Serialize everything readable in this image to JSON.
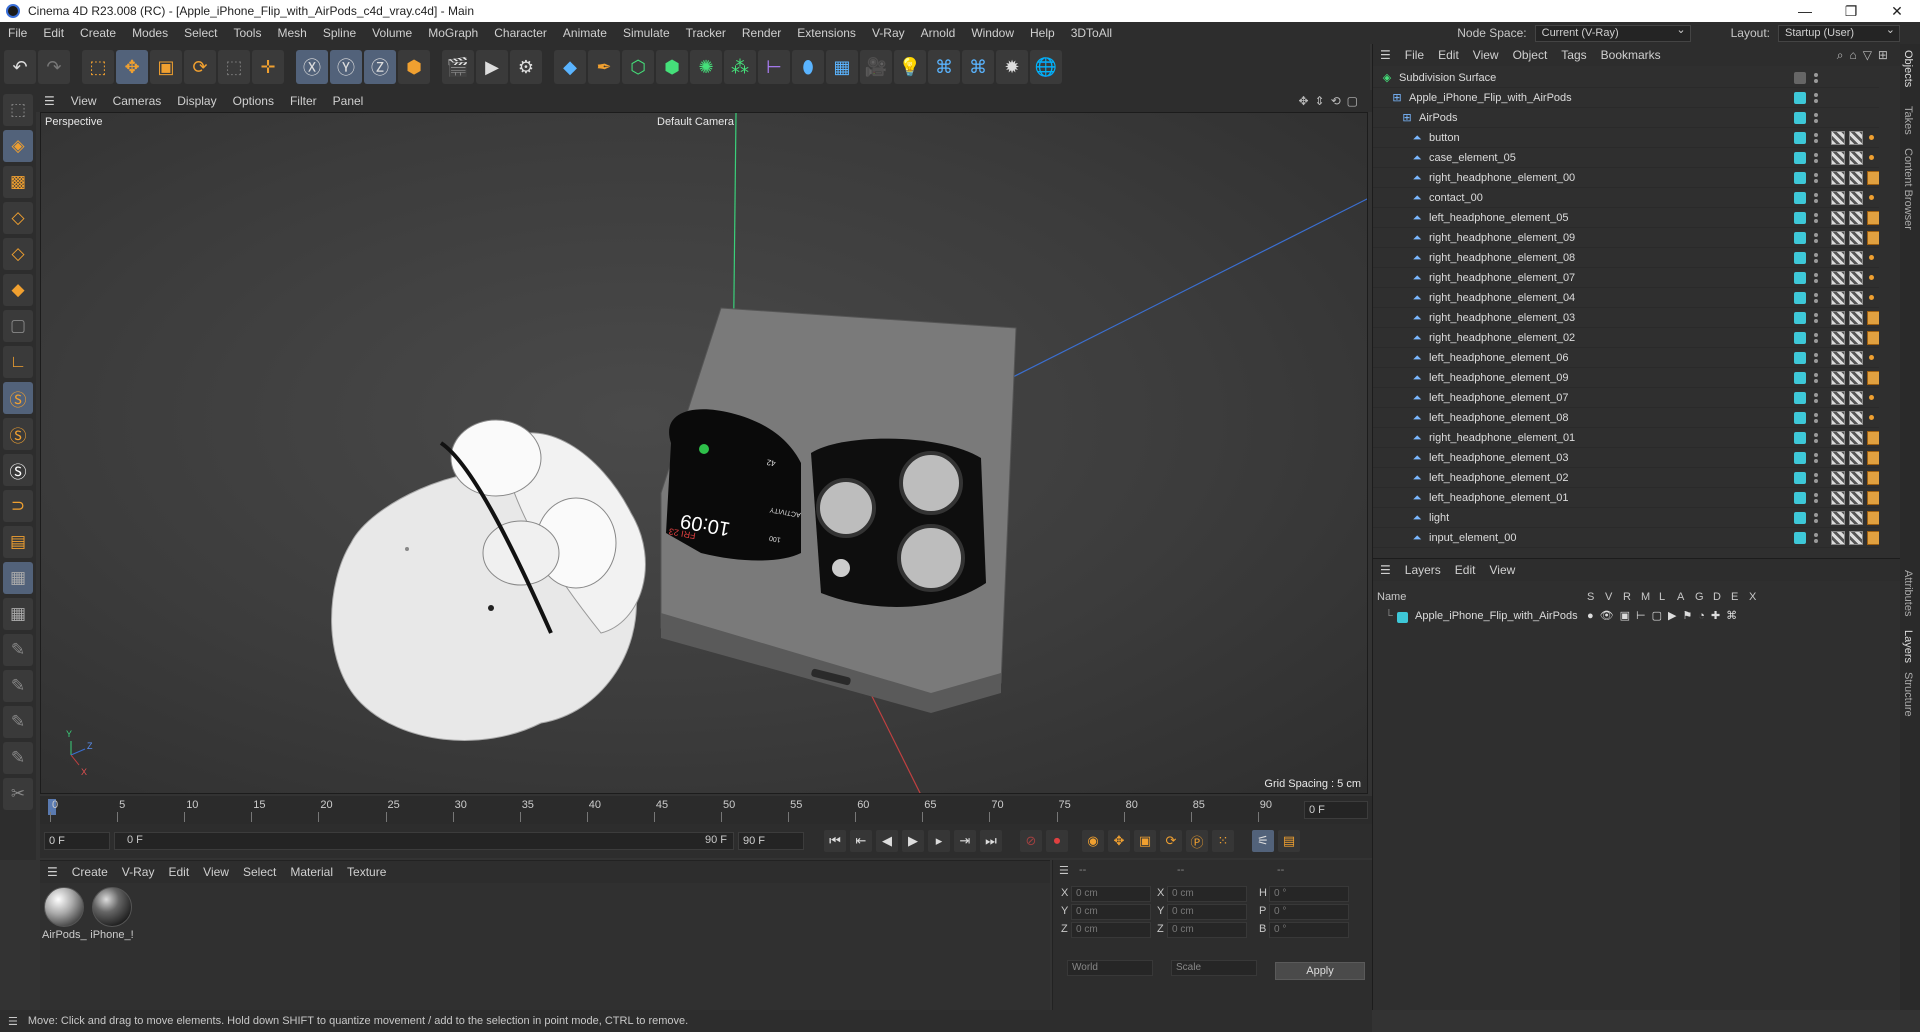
{
  "window": {
    "title": "Cinema 4D R23.008 (RC) - [Apple_iPhone_Flip_with_AirPods_c4d_vray.c4d] - Main",
    "controls": [
      "—",
      "❐",
      "✕"
    ]
  },
  "menubar": {
    "items": [
      "File",
      "Edit",
      "Create",
      "Modes",
      "Select",
      "Tools",
      "Mesh",
      "Spline",
      "Volume",
      "MoGraph",
      "Character",
      "Animate",
      "Simulate",
      "Tracker",
      "Render",
      "Extensions",
      "V-Ray",
      "Arnold",
      "Window",
      "Help",
      "3DToAll"
    ],
    "node_space_label": "Node Space:",
    "node_space_value": "Current (V-Ray)",
    "layout_label": "Layout:",
    "layout_value": "Startup (User)"
  },
  "viewport": {
    "menu": [
      "View",
      "Cameras",
      "Display",
      "Options",
      "Filter",
      "Panel"
    ],
    "view_name": "Perspective",
    "camera_label": "Default Camera",
    "grid_spacing": "Grid Spacing : 5 cm",
    "phone_time": "10:09",
    "phone_date": "FRI 23",
    "phone_activity": "ACTIVITY",
    "phone_badge1": "100",
    "phone_badge2": "42",
    "axis_labels": {
      "y": "Y",
      "z": "Z",
      "x": "X"
    }
  },
  "timeline": {
    "ticks": [
      "0",
      "5",
      "10",
      "15",
      "20",
      "25",
      "30",
      "35",
      "40",
      "45",
      "50",
      "55",
      "60",
      "65",
      "70",
      "75",
      "80",
      "85",
      "90"
    ],
    "current_frame": "0 F",
    "start_field": "0 F",
    "range_start": "0 F",
    "range_end": "90 F",
    "end_field": "90 F"
  },
  "material_manager": {
    "menu": [
      "Create",
      "V-Ray",
      "Edit",
      "View",
      "Select",
      "Material",
      "Texture"
    ],
    "materials": [
      {
        "name": "AirPods_"
      },
      {
        "name": "iPhone_!"
      }
    ]
  },
  "coordinates": {
    "header": [
      "--",
      "--",
      "--"
    ],
    "rows": [
      {
        "a": "X",
        "av": "0 cm",
        "b": "X",
        "bv": "0 cm",
        "c": "H",
        "cv": "0 °"
      },
      {
        "a": "Y",
        "av": "0 cm",
        "b": "Y",
        "bv": "0 cm",
        "c": "P",
        "cv": "0 °"
      },
      {
        "a": "Z",
        "av": "0 cm",
        "b": "Z",
        "bv": "0 cm",
        "c": "B",
        "cv": "0 °"
      }
    ],
    "space": "World",
    "mode": "Scale",
    "apply": "Apply"
  },
  "statusbar": {
    "text": "Move: Click and drag to move elements. Hold down SHIFT to quantize movement / add to the selection in point mode, CTRL to remove."
  },
  "object_manager": {
    "menu": [
      "File",
      "Edit",
      "View",
      "Object",
      "Tags",
      "Bookmarks"
    ],
    "objects": [
      {
        "name": "Subdivision Surface",
        "level": 0,
        "tags": 0
      },
      {
        "name": "Apple_iPhone_Flip_with_AirPods",
        "level": 1,
        "tags": 0
      },
      {
        "name": "AirPods",
        "level": 2,
        "tags": 0
      },
      {
        "name": "button",
        "level": 3,
        "tags": 1
      },
      {
        "name": "case_element_05",
        "level": 3,
        "tags": 1
      },
      {
        "name": "right_headphone_element_00",
        "level": 3,
        "tags": 2
      },
      {
        "name": "contact_00",
        "level": 3,
        "tags": 1
      },
      {
        "name": "left_headphone_element_05",
        "level": 3,
        "tags": 2
      },
      {
        "name": "right_headphone_element_09",
        "level": 3,
        "tags": 2
      },
      {
        "name": "right_headphone_element_08",
        "level": 3,
        "tags": 1
      },
      {
        "name": "right_headphone_element_07",
        "level": 3,
        "tags": 1
      },
      {
        "name": "right_headphone_element_04",
        "level": 3,
        "tags": 1
      },
      {
        "name": "right_headphone_element_03",
        "level": 3,
        "tags": 2
      },
      {
        "name": "right_headphone_element_02",
        "level": 3,
        "tags": 2
      },
      {
        "name": "left_headphone_element_06",
        "level": 3,
        "tags": 1
      },
      {
        "name": "left_headphone_element_09",
        "level": 3,
        "tags": 2
      },
      {
        "name": "left_headphone_element_07",
        "level": 3,
        "tags": 1
      },
      {
        "name": "left_headphone_element_08",
        "level": 3,
        "tags": 1
      },
      {
        "name": "right_headphone_element_01",
        "level": 3,
        "tags": 2
      },
      {
        "name": "left_headphone_element_03",
        "level": 3,
        "tags": 2
      },
      {
        "name": "left_headphone_element_02",
        "level": 3,
        "tags": 2
      },
      {
        "name": "left_headphone_element_01",
        "level": 3,
        "tags": 2
      },
      {
        "name": "light",
        "level": 3,
        "tags": 2
      },
      {
        "name": "input_element_00",
        "level": 3,
        "tags": 2
      }
    ]
  },
  "layers": {
    "menu": [
      "Layers",
      "Edit",
      "View"
    ],
    "columns": [
      "Name",
      "S",
      "V",
      "R",
      "M",
      "L",
      "A",
      "G",
      "D",
      "E",
      "X"
    ],
    "rows": [
      {
        "name": "Apple_iPhone_Flip_with_AirPods"
      }
    ]
  },
  "side_tabs": [
    "Objects",
    "Takes",
    "Content Browser",
    "Attributes",
    "Layers",
    "Structure"
  ],
  "colors": {
    "accent": "#f0a030",
    "layer_color": "#3ec8d8",
    "selection": "#52627a"
  }
}
